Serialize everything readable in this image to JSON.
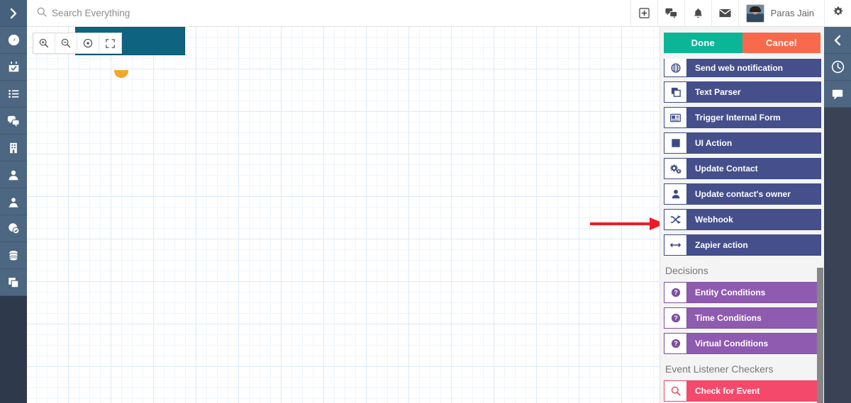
{
  "header": {
    "search": {
      "placeholder": "Search Everything",
      "value": "",
      "icon": "search-icon"
    },
    "actions": [
      {
        "name": "add-new-button",
        "icon": "plus-square-icon"
      },
      {
        "name": "chat-button",
        "icon": "comments-icon"
      },
      {
        "name": "notifications-button",
        "icon": "bell-icon"
      },
      {
        "name": "messages-button",
        "icon": "envelope-icon"
      }
    ],
    "user": {
      "name": "Paras Jain",
      "avatar": "user-avatar"
    },
    "settings": {
      "icon": "gear-icon"
    }
  },
  "left_rail": {
    "expand": {
      "icon": "chevron-right-icon"
    },
    "items": [
      {
        "name": "sidebar-item-dashboard",
        "icon": "dashboard-icon"
      },
      {
        "name": "sidebar-item-calendar",
        "icon": "calendar-check-icon"
      },
      {
        "name": "sidebar-item-tasks",
        "icon": "list-icon"
      },
      {
        "name": "sidebar-item-conversations",
        "icon": "comments-icon"
      },
      {
        "name": "sidebar-item-company",
        "icon": "building-icon"
      },
      {
        "name": "sidebar-item-contacts",
        "icon": "user-icon"
      },
      {
        "name": "sidebar-item-leads",
        "icon": "user-circle-icon"
      },
      {
        "name": "sidebar-item-approvals",
        "icon": "clock-check-icon"
      },
      {
        "name": "sidebar-item-database",
        "icon": "database-icon"
      },
      {
        "name": "sidebar-item-files",
        "icon": "clone-icon"
      }
    ]
  },
  "right_rail": {
    "items": [
      {
        "name": "collapse-panel-button",
        "icon": "chevron-left-icon"
      },
      {
        "name": "history-button",
        "icon": "clock-icon"
      },
      {
        "name": "comments-button",
        "icon": "comment-icon"
      }
    ]
  },
  "canvas": {
    "zoom_toolbar": [
      {
        "name": "zoom-in-button",
        "icon": "zoom-in-icon"
      },
      {
        "name": "zoom-out-button",
        "icon": "zoom-out-icon"
      },
      {
        "name": "zoom-reset-button",
        "icon": "crosshair-icon"
      },
      {
        "name": "fit-screen-button",
        "icon": "expand-icon"
      }
    ],
    "node": {
      "name": "workflow-start-node",
      "color": "#0e6480"
    },
    "annotation": {
      "name": "red-arrow-annotation",
      "color": "#ee1c25",
      "points_to": "Webhook"
    }
  },
  "panel": {
    "done_label": "Done",
    "cancel_label": "Cancel",
    "colors": {
      "done": "#0bb696",
      "cancel": "#f9694b",
      "action": "#454f8c",
      "decision": "#8f5bb1",
      "checker": "#f5496b"
    },
    "actions": [
      {
        "label": "Send web notification",
        "icon": "globe-icon",
        "clipped": true
      },
      {
        "label": "Text Parser",
        "icon": "clone-icon",
        "clipped": false
      },
      {
        "label": "Trigger Internal Form",
        "icon": "id-card-icon",
        "clipped": false
      },
      {
        "label": "UI Action",
        "icon": "square-icon",
        "clipped": false
      },
      {
        "label": "Update Contact",
        "icon": "cogs-icon",
        "clipped": false
      },
      {
        "label": "Update contact's owner",
        "icon": "user-icon",
        "clipped": false
      },
      {
        "label": "Webhook",
        "icon": "shuffle-icon",
        "clipped": false
      },
      {
        "label": "Zapier action",
        "icon": "arrows-h-icon",
        "clipped": false
      }
    ],
    "decisions_title": "Decisions",
    "decisions": [
      {
        "label": "Entity Conditions",
        "icon": "question-circle-icon"
      },
      {
        "label": "Time Conditions",
        "icon": "question-circle-icon"
      },
      {
        "label": "Virtual Conditions",
        "icon": "question-circle-icon"
      }
    ],
    "checkers_title": "Event Listener Checkers",
    "checkers": [
      {
        "label": "Check for Event",
        "icon": "search-icon"
      }
    ]
  }
}
